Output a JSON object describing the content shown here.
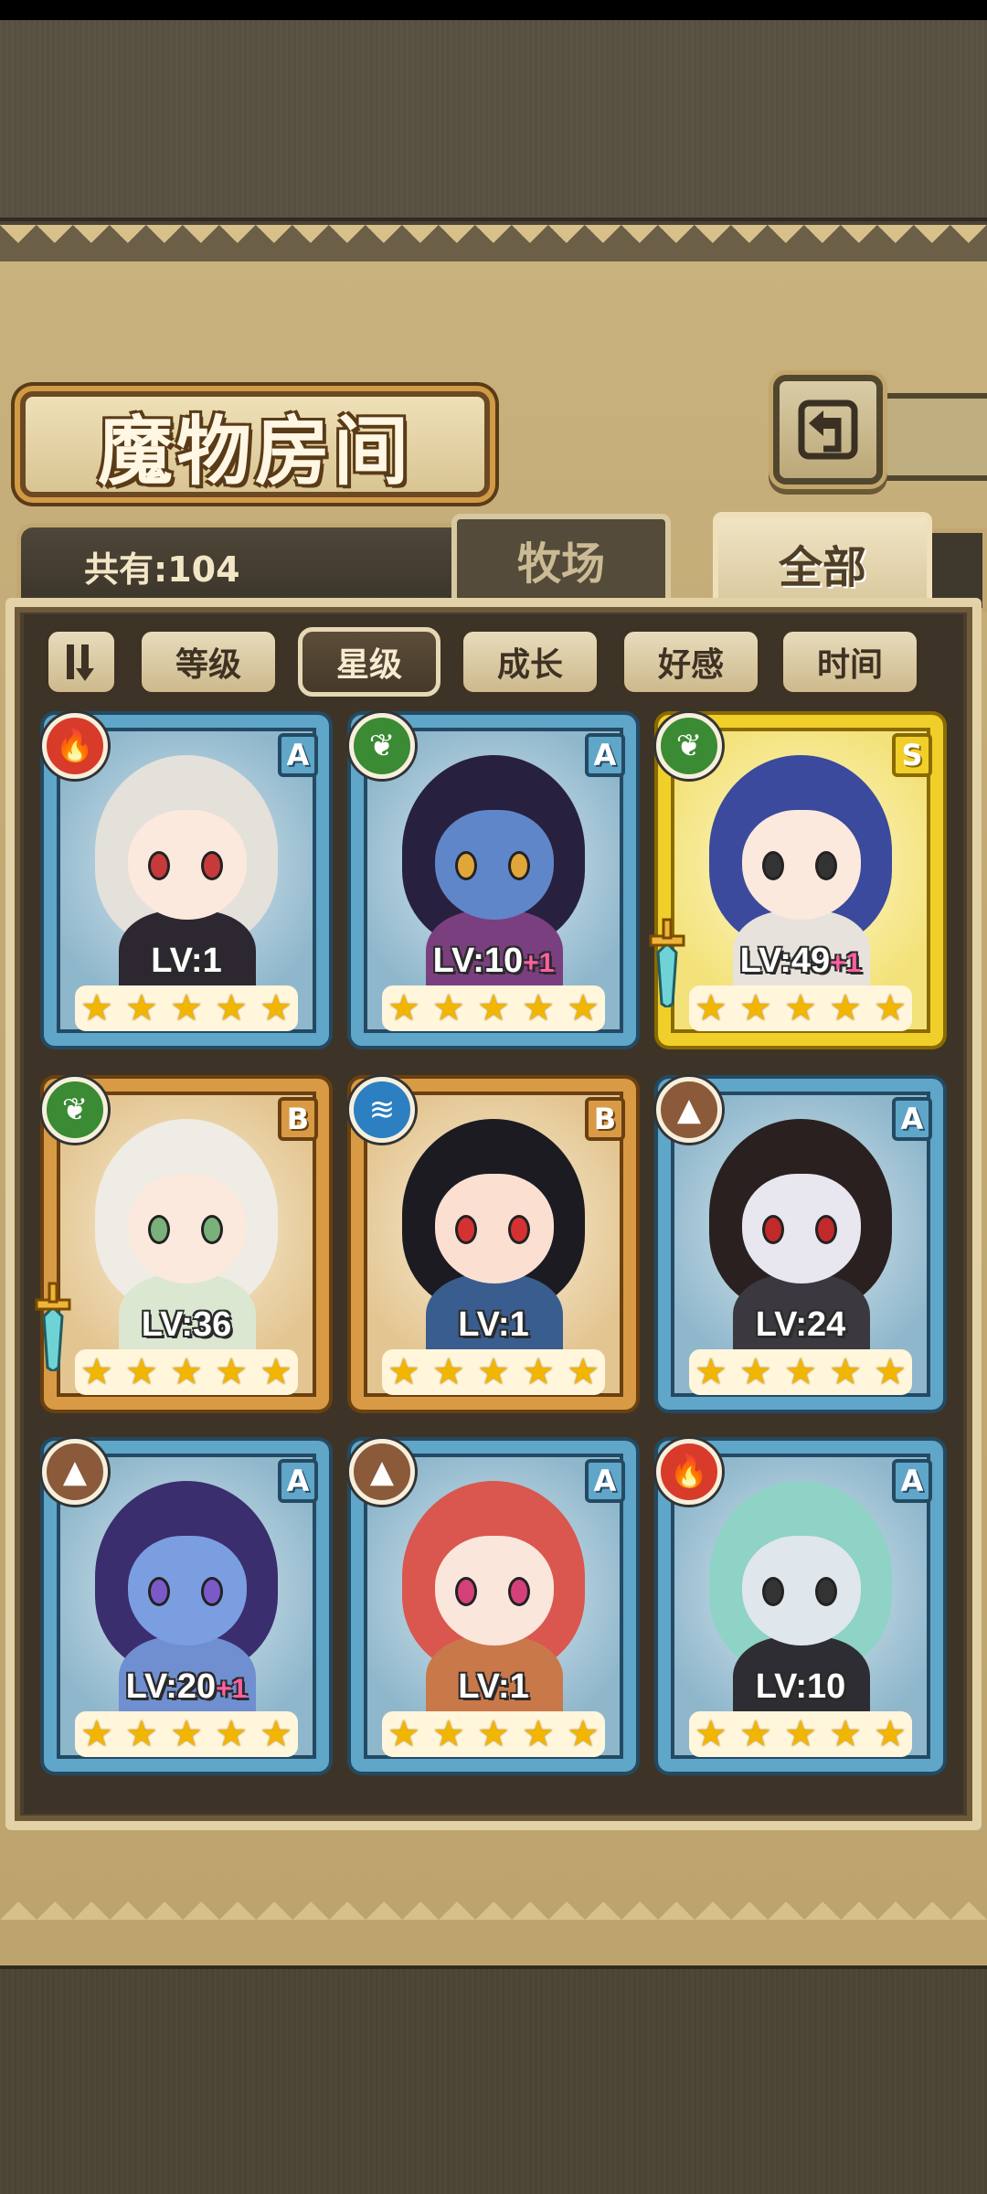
{
  "header": {
    "title": "魔物房间"
  },
  "count": {
    "label": "共有:104"
  },
  "tabs": [
    {
      "label": "牧场",
      "active": false
    },
    {
      "label": "全部",
      "active": true
    }
  ],
  "sort": {
    "buttons": [
      {
        "label": "等级",
        "active": false
      },
      {
        "label": "星级",
        "active": true
      },
      {
        "label": "成长",
        "active": false
      },
      {
        "label": "好感",
        "active": false
      },
      {
        "label": "时间",
        "active": false
      }
    ]
  },
  "monsters": [
    {
      "level": "LV:1",
      "plus": "",
      "rank": "A",
      "element": "fire",
      "element_color": "#d83b2a",
      "frame": "#5fa6c9",
      "frame_dark": "#244a63",
      "stars": 5,
      "weapon": false,
      "hair": "#e4e0da",
      "skin": "#fbe9dd",
      "eye": "#c83a3a",
      "outfit": "#2c2730",
      "art_bg": "#8fb7cc",
      "art_light": "#dbe9ef"
    },
    {
      "level": "LV:10",
      "plus": "+1",
      "rank": "A",
      "element": "leaf",
      "element_color": "#3b8a34",
      "frame": "#5fa6c9",
      "frame_dark": "#244a63",
      "stars": 5,
      "weapon": false,
      "hair": "#27203f",
      "skin": "#5f86c8",
      "eye": "#e0a63a",
      "outfit": "#7a3f7f",
      "art_bg": "#8fb7cc",
      "art_light": "#dbe9ef"
    },
    {
      "level": "LV:49",
      "plus": "+1",
      "rank": "S",
      "element": "leaf",
      "element_color": "#3b8a34",
      "frame": "#f1cf2b",
      "frame_dark": "#8a6a00",
      "stars": 5,
      "weapon": true,
      "hair": "#3b4a9c",
      "skin": "#fbe9dd",
      "eye": "#333",
      "outfit": "#e7e3dc",
      "art_bg": "#f3e27a",
      "art_light": "#fff8cf"
    },
    {
      "level": "LV:36",
      "plus": "",
      "rank": "B",
      "element": "leaf",
      "element_color": "#3b8a34",
      "frame": "#d89a45",
      "frame_dark": "#6b4010",
      "stars": 5,
      "weapon": true,
      "hair": "#eeece4",
      "skin": "#fbe9dd",
      "eye": "#7ab07a",
      "outfit": "#dbe7d0",
      "art_bg": "#e3c591",
      "art_light": "#fbf1db"
    },
    {
      "level": "LV:1",
      "plus": "",
      "rank": "B",
      "element": "water",
      "element_color": "#2c7fc0",
      "frame": "#d89a45",
      "frame_dark": "#6b4010",
      "stars": 5,
      "weapon": false,
      "hair": "#1c1b22",
      "skin": "#fbe0d2",
      "eye": "#d43232",
      "outfit": "#3a5d8f",
      "art_bg": "#e3c591",
      "art_light": "#fbf1db"
    },
    {
      "level": "LV:24",
      "plus": "",
      "rank": "A",
      "element": "earth",
      "element_color": "#8a5a3a",
      "frame": "#5fa6c9",
      "frame_dark": "#244a63",
      "stars": 5,
      "weapon": false,
      "hair": "#2a2020",
      "skin": "#e8e6ee",
      "eye": "#c02a2a",
      "outfit": "#3b3840",
      "art_bg": "#8fb7cc",
      "art_light": "#dbe9ef"
    },
    {
      "level": "LV:20",
      "plus": "+1",
      "rank": "A",
      "element": "earth",
      "element_color": "#8a5a3a",
      "frame": "#5fa6c9",
      "frame_dark": "#244a63",
      "stars": 5,
      "weapon": false,
      "hair": "#3a2e6e",
      "skin": "#7b9ee0",
      "eye": "#7a5ac8",
      "outfit": "#6f8fd0",
      "art_bg": "#8fb7cc",
      "art_light": "#dbe9ef"
    },
    {
      "level": "LV:1",
      "plus": "",
      "rank": "A",
      "element": "earth",
      "element_color": "#8a5a3a",
      "frame": "#5fa6c9",
      "frame_dark": "#244a63",
      "stars": 5,
      "weapon": false,
      "hair": "#d9574f",
      "skin": "#fbe6dc",
      "eye": "#d4407a",
      "outfit": "#c9784a",
      "art_bg": "#8fb7cc",
      "art_light": "#dbe9ef"
    },
    {
      "level": "LV:10",
      "plus": "",
      "rank": "A",
      "element": "fire",
      "element_color": "#d83b2a",
      "frame": "#5fa6c9",
      "frame_dark": "#244a63",
      "stars": 5,
      "weapon": false,
      "hair": "#8fd2c6",
      "skin": "#dfe6ec",
      "eye": "#333",
      "outfit": "#2d2d33",
      "art_bg": "#8fb7cc",
      "art_light": "#dbe9ef"
    }
  ],
  "icons": {
    "fire": "fire-icon",
    "leaf": "leaf-icon",
    "water": "water-icon",
    "earth": "earth-icon",
    "back": "return-arrow-icon",
    "sort": "sort-order-icon"
  },
  "colors": {
    "parchment": "#c2a974",
    "panel": "#3d3427"
  }
}
